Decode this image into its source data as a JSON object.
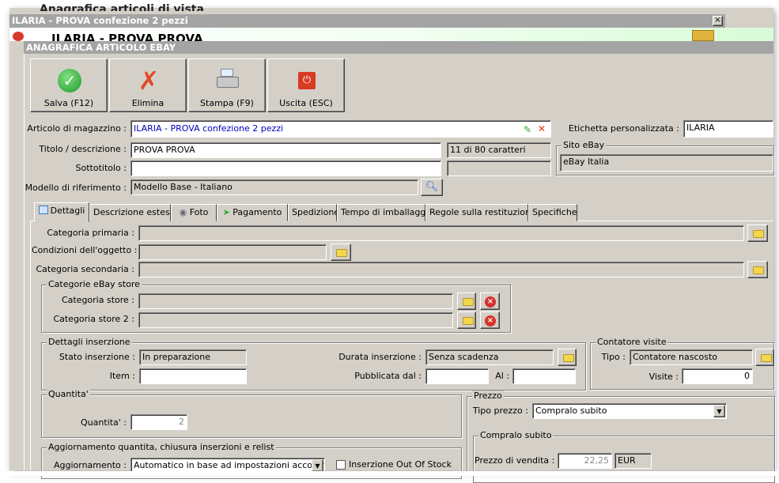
{
  "back_window": {
    "title": "Anagrafica articoli di vista",
    "subtitle": "ILARIA - PROVA PROVA"
  },
  "outer_window": {
    "title": "ILARIA - PROVA confezione 2 pezzi",
    "close": "×"
  },
  "window": {
    "title": "ANAGRAFICA ARTICOLO EBAY"
  },
  "toolbar": {
    "save": "Salva (F12)",
    "delete": "Elimina",
    "print": "Stampa (F9)",
    "exit": "Uscita (ESC)"
  },
  "form": {
    "articolo_label": "Articolo di magazzino :",
    "articolo_value": "ILARIA - PROVA confezione 2 pezzi",
    "etichetta_label": "Etichetta personalizzata :",
    "etichetta_value": "ILARIA",
    "titolo_label": "Titolo / descrizione :",
    "titolo_value": "PROVA PROVA",
    "titolo_counter": "11 di 80 caratteri",
    "sottotitolo_label": "Sottotitolo :",
    "sottotitolo_value": "",
    "sito_group": "Sito eBay",
    "sito_value": "eBay Italia",
    "modello_label": "Modello di riferimento :",
    "modello_value": "Modello Base - Italiano"
  },
  "tabs": [
    {
      "label": "Dettagli"
    },
    {
      "label": "Descrizione estesa"
    },
    {
      "label": "Foto"
    },
    {
      "label": "Pagamento"
    },
    {
      "label": "Spedizione"
    },
    {
      "label": "Tempo di imballaggio"
    },
    {
      "label": "Regole sulla restituzione"
    },
    {
      "label": "Specifiche"
    }
  ],
  "details": {
    "cat_primaria": "Categoria primaria :",
    "condizioni": "Condizioni dell'oggetto :",
    "cat_secondaria": "Categoria secondaria :",
    "store_group": "Categorie eBay store",
    "cat_store": "Categoria store :",
    "cat_store2": "Categoria store 2 :",
    "ins_group": "Dettagli inserzione",
    "stato_label": "Stato inserzione :",
    "stato_value": "In preparazione",
    "item_label": "Item :",
    "durata_label": "Durata inserzione :",
    "durata_value": "Senza scadenza",
    "pubblicata_label": "Pubblicata dal :",
    "al_label": "Al :",
    "contatore_group": "Contatore visite",
    "tipo_label": "Tipo :",
    "tipo_value": "Contatore nascosto",
    "visite_label": "Visite :",
    "visite_value": "0",
    "qta_group": "Quantita'",
    "qta_label": "Quantita' :",
    "qta_value": "2",
    "agg_group": "Aggiornamento quantita, chiusura inserzioni e relist",
    "agg_label": "Aggiornamento :",
    "agg_value": "Automatico in base ad impostazioni account",
    "oos_label": "Inserzione Out Of Stock",
    "prezzo_group": "Prezzo",
    "tipo_prezzo_label": "Tipo prezzo :",
    "tipo_prezzo_value": "Compralo subito",
    "compralo_group": "Compralo subito",
    "prezzo_label": "Prezzo di vendita :",
    "prezzo_value": "22,25",
    "valuta": "EUR"
  },
  "colors": {
    "titlebar": "#a4a4a4",
    "face": "#d4d0c8",
    "link_text": "#0000c0"
  }
}
